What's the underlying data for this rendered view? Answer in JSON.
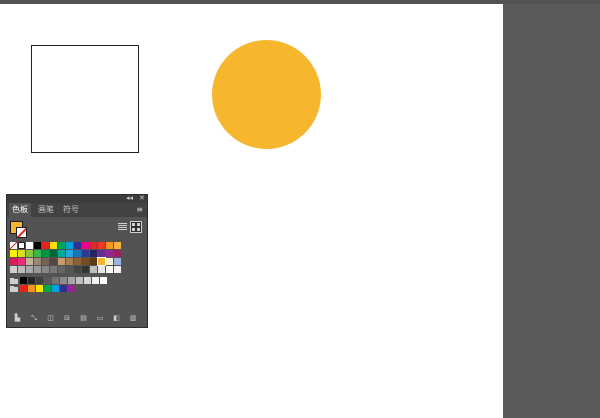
{
  "canvas": {
    "circle_color": "#f6b72f",
    "rect_fill": "#ffffff",
    "rect_stroke": "#222222"
  },
  "panel": {
    "controls": {
      "collapse": "◂◂",
      "close": "✕"
    },
    "tabs": [
      "色板",
      "画笔",
      "符号"
    ],
    "active_tab": "色板",
    "fill_color": "#f6b72f",
    "menu_icon": "≡",
    "swatch_rows": [
      [
        "none",
        "registration",
        "#ffffff",
        "#000000",
        "#e8221c",
        "#ffe100",
        "#00a64f",
        "#00a3e0",
        "#2e3192",
        "#ec008c",
        "#d62a30",
        "#ee3a24",
        "#f7941d",
        "#fbb040"
      ],
      [
        "#fff200",
        "#d7df23",
        "#8dc63f",
        "#39b54a",
        "#009444",
        "#006838",
        "#00a99d",
        "#27aae1",
        "#1c75bc",
        "#2b3990",
        "#262262",
        "#662d91",
        "#92278f",
        "#9e1f63"
      ],
      [
        "#da1c5c",
        "#ee2a7b",
        "#c2b59b",
        "#998675",
        "#736357",
        "#534741",
        "#c69c6d",
        "#a67c52",
        "#8c6239",
        "#754c24",
        "#603813",
        "#f6b72f",
        "#f7f1ce",
        "#9bb4e5"
      ],
      [
        "#cfcfcf",
        "#bcbcbc",
        "#aaaaaa",
        "#999999",
        "#888888",
        "#777777",
        "#666666",
        "#555555",
        "#444444",
        "#333333",
        "#c0c0c0",
        "#e6e6e6",
        "#ffffff",
        "#f2f2f2"
      ],
      [
        "#000000",
        "#262626",
        "#404040",
        "#595959",
        "#737373",
        "#8c8c8c",
        "#a6a6a6",
        "#bfbfbf",
        "#d9d9d9",
        "#f2f2f2",
        "#ffffff"
      ],
      [
        "#e8221c",
        "#f7941d",
        "#ffe100",
        "#00a64f",
        "#00a3e0",
        "#2e3192",
        "#92278f"
      ]
    ],
    "bottom_icons": [
      "swatch-libraries-icon",
      "place-swatches-icon",
      "swatch-kind-icon",
      "swatch-options-icon",
      "new-color-group-icon",
      "new-folder-icon",
      "new-swatch-icon",
      "delete-icon"
    ]
  }
}
